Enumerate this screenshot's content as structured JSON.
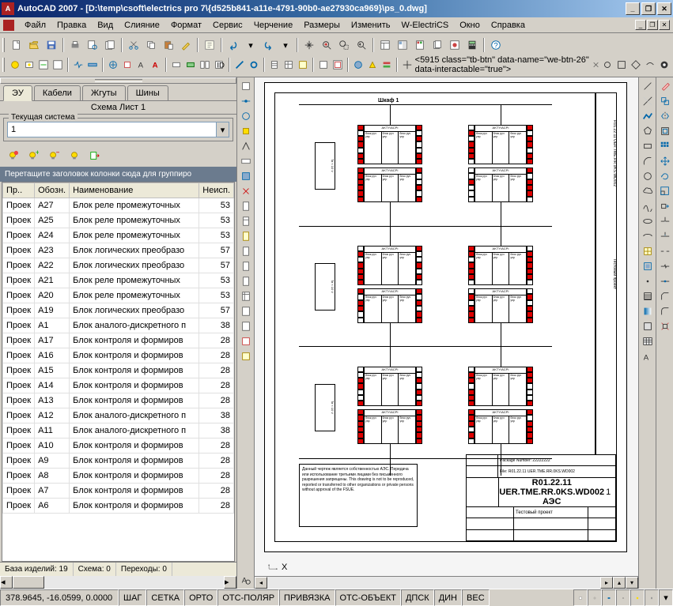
{
  "window": {
    "app_name": "AutoCAD 2007",
    "document_path": "[D:\\temp\\csoft\\electrics pro 7\\{d525b841-a11e-4791-90b0-ae27930ca969}\\ps_0.dwg]"
  },
  "menubar": {
    "items": [
      "Файл",
      "Правка",
      "Вид",
      "Слияние",
      "Формат",
      "Сервис",
      "Черчение",
      "Размеры",
      "Изменить",
      "W-ElectriCS",
      "Окно",
      "Справка"
    ]
  },
  "left_panel": {
    "tabs": [
      "ЭУ",
      "Кабели",
      "Жгуты",
      "Шины"
    ],
    "active_tab": 0,
    "schema_label": "Схема  Лист 1",
    "current_system_label": "Текущая система",
    "current_system_value": "1",
    "group_hint": "Перетащите заголовок колонки сюда для группиро",
    "columns": [
      "Пр..",
      "Обозн.",
      "Наименование",
      "Неисп."
    ],
    "rows": [
      {
        "pr": "Проек",
        "ob": "A27",
        "name": "Блок реле промежуточных",
        "ne": "53"
      },
      {
        "pr": "Проек",
        "ob": "A25",
        "name": "Блок реле промежуточных",
        "ne": "53"
      },
      {
        "pr": "Проек",
        "ob": "A24",
        "name": "Блок реле промежуточных",
        "ne": "53"
      },
      {
        "pr": "Проек",
        "ob": "A23",
        "name": "Блок логических преобразо",
        "ne": "57"
      },
      {
        "pr": "Проек",
        "ob": "A22",
        "name": "Блок логических преобразо",
        "ne": "57"
      },
      {
        "pr": "Проек",
        "ob": "A21",
        "name": "Блок реле промежуточных",
        "ne": "53"
      },
      {
        "pr": "Проек",
        "ob": "A20",
        "name": "Блок реле промежуточных",
        "ne": "53"
      },
      {
        "pr": "Проек",
        "ob": "A19",
        "name": "Блок логических преобразо",
        "ne": "57"
      },
      {
        "pr": "Проек",
        "ob": "A1",
        "name": "Блок аналого-дискретного п",
        "ne": "38"
      },
      {
        "pr": "Проек",
        "ob": "A17",
        "name": "Блок контроля и формиров",
        "ne": "28"
      },
      {
        "pr": "Проек",
        "ob": "A16",
        "name": "Блок контроля и формиров",
        "ne": "28"
      },
      {
        "pr": "Проек",
        "ob": "A15",
        "name": "Блок контроля и формиров",
        "ne": "28"
      },
      {
        "pr": "Проек",
        "ob": "A14",
        "name": "Блок контроля и формиров",
        "ne": "28"
      },
      {
        "pr": "Проек",
        "ob": "A13",
        "name": "Блок контроля и формиров",
        "ne": "28"
      },
      {
        "pr": "Проек",
        "ob": "A12",
        "name": "Блок аналого-дискретного п",
        "ne": "38"
      },
      {
        "pr": "Проек",
        "ob": "A11",
        "name": "Блок аналого-дискретного п",
        "ne": "38"
      },
      {
        "pr": "Проек",
        "ob": "A10",
        "name": "Блок контроля и формиров",
        "ne": "28"
      },
      {
        "pr": "Проек",
        "ob": "A9",
        "name": "Блок контроля и формиров",
        "ne": "28"
      },
      {
        "pr": "Проек",
        "ob": "A8",
        "name": "Блок контроля и формиров",
        "ne": "28"
      },
      {
        "pr": "Проек",
        "ob": "A7",
        "name": "Блок контроля и формиров",
        "ne": "28"
      },
      {
        "pr": "Проек",
        "ob": "A6",
        "name": "Блок контроля и формиров",
        "ne": "28"
      }
    ],
    "status": {
      "base": "База изделий: 19",
      "schema": "Схема: 0",
      "trans": "Переходы: 0"
    }
  },
  "drawing": {
    "sheet_label": "Шкаф 1",
    "title_block": {
      "code": "R01.22.11  UER.TME.RR.0KS.WD002",
      "org": "АЭС",
      "sheet": "1",
      "project": "Тестовый проект",
      "package": "Package Number:   22222222",
      "file": "File: R01.22.11  UER.TME.RR.0KS.WD002"
    },
    "side_code": "R01.22.11 UER.TME.RR.0KS.WD002",
    "side_label2": "Тестовый проект",
    "note_text": "Данный чертеж является собственностью АЭС. Передача или использование третьими лицами без письменного разрешения запрещены.\nThis drawing is not to be reproduced, reported or transferred to other organizations or private persons without approval of the FSUE."
  },
  "statusbar": {
    "coords": "378.9645, -16.0599, 0.0000",
    "toggles": [
      "ШАГ",
      "СЕТКА",
      "ОРТО",
      "ОТС-ПОЛЯР",
      "ПРИВЯЗКА",
      "ОТС-ОБЪЕКТ",
      "ДПСК",
      "ДИН",
      "ВЕС"
    ]
  }
}
